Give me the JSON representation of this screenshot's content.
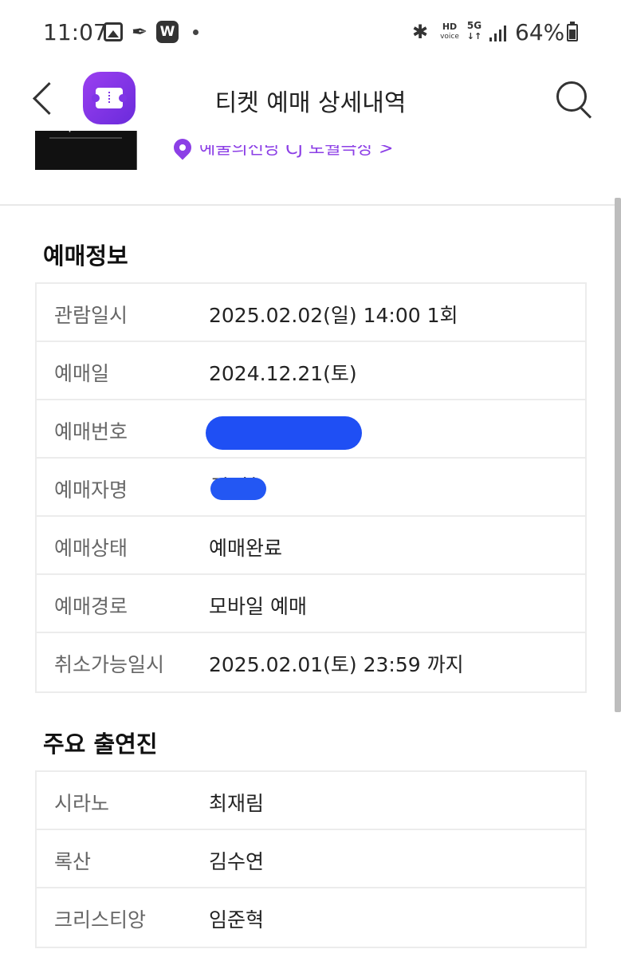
{
  "status_bar": {
    "time": "11:07",
    "left_icons": [
      "gallery-icon",
      "feather-icon",
      "w-app-icon",
      "notification-dot-icon"
    ],
    "hd_label": "HD",
    "hd_sub": "voice",
    "network": "5G",
    "battery": "64%"
  },
  "header": {
    "title": "티켓 예매 상세내역",
    "app_color": "#8c3fe6"
  },
  "event": {
    "venue": "예술의전당 CJ 토월극장 >"
  },
  "booking": {
    "heading": "예매정보",
    "rows": [
      {
        "label": "관람일시",
        "value": "2025.02.02(일) 14:00 1회"
      },
      {
        "label": "예매일",
        "value": "2024.12.21(토)"
      },
      {
        "label": "예매번호",
        "value": ""
      },
      {
        "label": "예매자명",
        "value": "김*현"
      },
      {
        "label": "예매상태",
        "value": "예매완료"
      },
      {
        "label": "예매경로",
        "value": "모바일 예매"
      },
      {
        "label": "취소가능일시",
        "value": "2025.02.01(토) 23:59 까지"
      }
    ]
  },
  "cast": {
    "heading": "주요 출연진",
    "rows": [
      {
        "label": "시라노",
        "value": "최재림"
      },
      {
        "label": "록산",
        "value": "김수연"
      },
      {
        "label": "크리스티앙",
        "value": "임준혁"
      }
    ]
  }
}
